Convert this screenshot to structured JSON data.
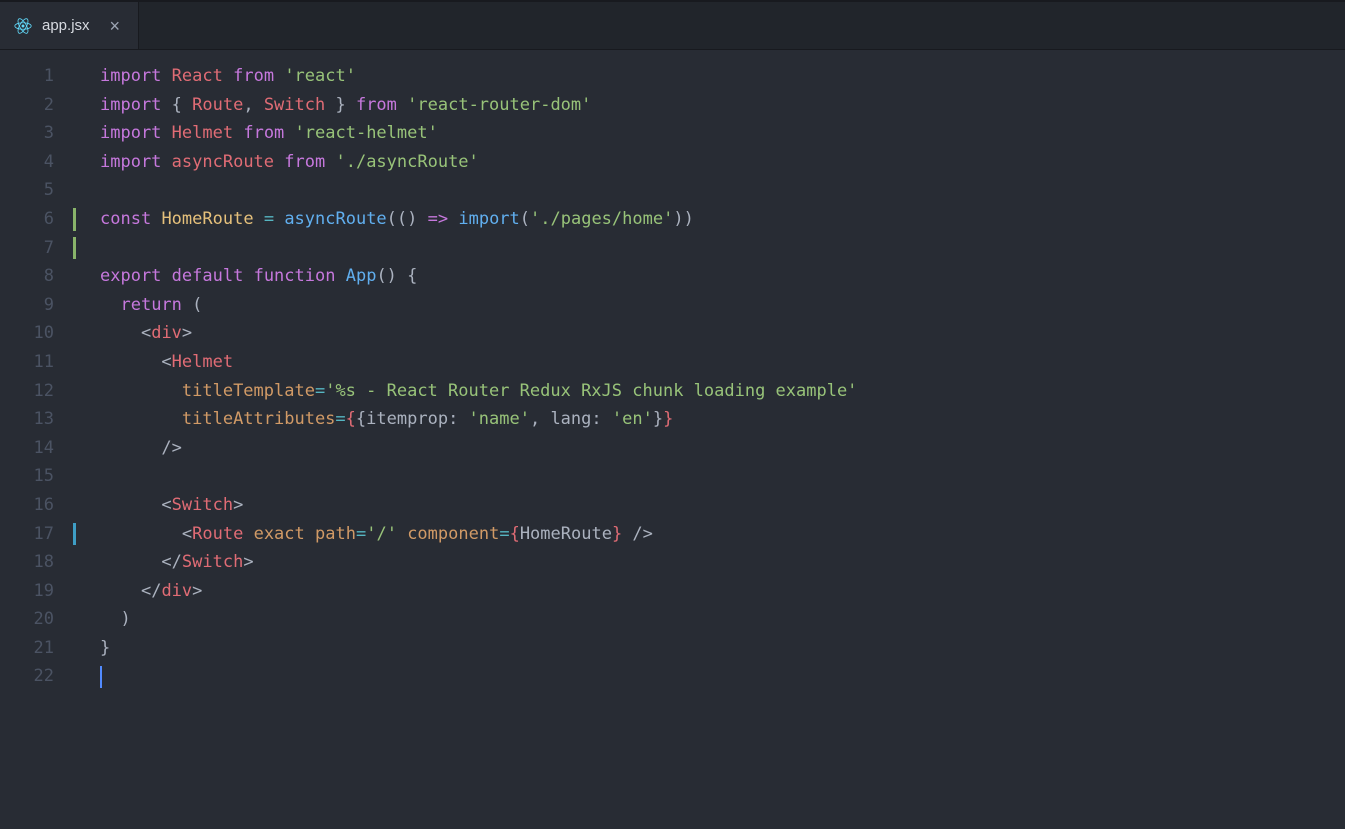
{
  "tab": {
    "file_name": "app.jsx",
    "icon": "react-icon"
  },
  "gutter": {
    "lines": 22,
    "markers": [
      {
        "line": 6,
        "kind": "green"
      },
      {
        "line": 7,
        "kind": "green"
      },
      {
        "line": 17,
        "kind": "cyan"
      }
    ]
  },
  "code": {
    "lines": [
      [
        {
          "t": "import",
          "c": "purple"
        },
        {
          "t": " ",
          "c": "grey"
        },
        {
          "t": "React",
          "c": "red"
        },
        {
          "t": " ",
          "c": "grey"
        },
        {
          "t": "from",
          "c": "purple"
        },
        {
          "t": " ",
          "c": "grey"
        },
        {
          "t": "'react'",
          "c": "green"
        }
      ],
      [
        {
          "t": "import",
          "c": "purple"
        },
        {
          "t": " { ",
          "c": "grey"
        },
        {
          "t": "Route",
          "c": "red"
        },
        {
          "t": ", ",
          "c": "grey"
        },
        {
          "t": "Switch",
          "c": "red"
        },
        {
          "t": " } ",
          "c": "grey"
        },
        {
          "t": "from",
          "c": "purple"
        },
        {
          "t": " ",
          "c": "grey"
        },
        {
          "t": "'react-router-dom'",
          "c": "green"
        }
      ],
      [
        {
          "t": "import",
          "c": "purple"
        },
        {
          "t": " ",
          "c": "grey"
        },
        {
          "t": "Helmet",
          "c": "red"
        },
        {
          "t": " ",
          "c": "grey"
        },
        {
          "t": "from",
          "c": "purple"
        },
        {
          "t": " ",
          "c": "grey"
        },
        {
          "t": "'react-helmet'",
          "c": "green"
        }
      ],
      [
        {
          "t": "import",
          "c": "purple"
        },
        {
          "t": " ",
          "c": "grey"
        },
        {
          "t": "asyncRoute",
          "c": "red"
        },
        {
          "t": " ",
          "c": "grey"
        },
        {
          "t": "from",
          "c": "purple"
        },
        {
          "t": " ",
          "c": "grey"
        },
        {
          "t": "'./asyncRoute'",
          "c": "green"
        }
      ],
      [],
      [
        {
          "t": "const",
          "c": "purple"
        },
        {
          "t": " ",
          "c": "grey"
        },
        {
          "t": "HomeRoute",
          "c": "yellow"
        },
        {
          "t": " ",
          "c": "grey"
        },
        {
          "t": "=",
          "c": "cyan"
        },
        {
          "t": " ",
          "c": "grey"
        },
        {
          "t": "asyncRoute",
          "c": "blue"
        },
        {
          "t": "(() ",
          "c": "grey"
        },
        {
          "t": "=>",
          "c": "purple"
        },
        {
          "t": " ",
          "c": "grey"
        },
        {
          "t": "import",
          "c": "blue"
        },
        {
          "t": "(",
          "c": "grey"
        },
        {
          "t": "'./pages/home'",
          "c": "green"
        },
        {
          "t": "))",
          "c": "grey"
        }
      ],
      [],
      [
        {
          "t": "export",
          "c": "purple"
        },
        {
          "t": " ",
          "c": "grey"
        },
        {
          "t": "default",
          "c": "purple"
        },
        {
          "t": " ",
          "c": "grey"
        },
        {
          "t": "function",
          "c": "purple"
        },
        {
          "t": " ",
          "c": "grey"
        },
        {
          "t": "App",
          "c": "blue"
        },
        {
          "t": "() {",
          "c": "grey"
        }
      ],
      [
        {
          "t": "  ",
          "c": "grey"
        },
        {
          "t": "return",
          "c": "purple"
        },
        {
          "t": " (",
          "c": "grey"
        }
      ],
      [
        {
          "t": "    ",
          "c": "grey"
        },
        {
          "t": "<",
          "c": "grey"
        },
        {
          "t": "div",
          "c": "red"
        },
        {
          "t": ">",
          "c": "grey"
        }
      ],
      [
        {
          "t": "      ",
          "c": "grey"
        },
        {
          "t": "<",
          "c": "grey"
        },
        {
          "t": "Helmet",
          "c": "red"
        }
      ],
      [
        {
          "t": "        ",
          "c": "grey"
        },
        {
          "t": "titleTemplate",
          "c": "orange"
        },
        {
          "t": "=",
          "c": "cyan"
        },
        {
          "t": "'%s - React Router Redux RxJS chunk loading example'",
          "c": "green"
        }
      ],
      [
        {
          "t": "        ",
          "c": "grey"
        },
        {
          "t": "titleAttributes",
          "c": "orange"
        },
        {
          "t": "=",
          "c": "cyan"
        },
        {
          "t": "{",
          "c": "red"
        },
        {
          "t": "{",
          "c": "grey"
        },
        {
          "t": "itemprop",
          "c": "grey"
        },
        {
          "t": ": ",
          "c": "grey"
        },
        {
          "t": "'name'",
          "c": "green"
        },
        {
          "t": ", lang: ",
          "c": "grey"
        },
        {
          "t": "'en'",
          "c": "green"
        },
        {
          "t": "}",
          "c": "grey"
        },
        {
          "t": "}",
          "c": "red"
        }
      ],
      [
        {
          "t": "      />",
          "c": "grey"
        }
      ],
      [],
      [
        {
          "t": "      ",
          "c": "grey"
        },
        {
          "t": "<",
          "c": "grey"
        },
        {
          "t": "Switch",
          "c": "red"
        },
        {
          "t": ">",
          "c": "grey"
        }
      ],
      [
        {
          "t": "        ",
          "c": "grey"
        },
        {
          "t": "<",
          "c": "grey"
        },
        {
          "t": "Route",
          "c": "red"
        },
        {
          "t": " ",
          "c": "grey"
        },
        {
          "t": "exact",
          "c": "orange"
        },
        {
          "t": " ",
          "c": "grey"
        },
        {
          "t": "path",
          "c": "orange"
        },
        {
          "t": "=",
          "c": "cyan"
        },
        {
          "t": "'/'",
          "c": "green"
        },
        {
          "t": " ",
          "c": "grey"
        },
        {
          "t": "component",
          "c": "orange"
        },
        {
          "t": "=",
          "c": "cyan"
        },
        {
          "t": "{",
          "c": "red"
        },
        {
          "t": "HomeRoute",
          "c": "grey"
        },
        {
          "t": "}",
          "c": "red"
        },
        {
          "t": " />",
          "c": "grey"
        }
      ],
      [
        {
          "t": "      ",
          "c": "grey"
        },
        {
          "t": "</",
          "c": "grey"
        },
        {
          "t": "Switch",
          "c": "red"
        },
        {
          "t": ">",
          "c": "grey"
        }
      ],
      [
        {
          "t": "    ",
          "c": "grey"
        },
        {
          "t": "</",
          "c": "grey"
        },
        {
          "t": "div",
          "c": "red"
        },
        {
          "t": ">",
          "c": "grey"
        }
      ],
      [
        {
          "t": "  )",
          "c": "grey"
        }
      ],
      [
        {
          "t": "}",
          "c": "grey"
        }
      ],
      [
        {
          "t": "",
          "c": "grey",
          "cursor": true
        }
      ]
    ]
  }
}
